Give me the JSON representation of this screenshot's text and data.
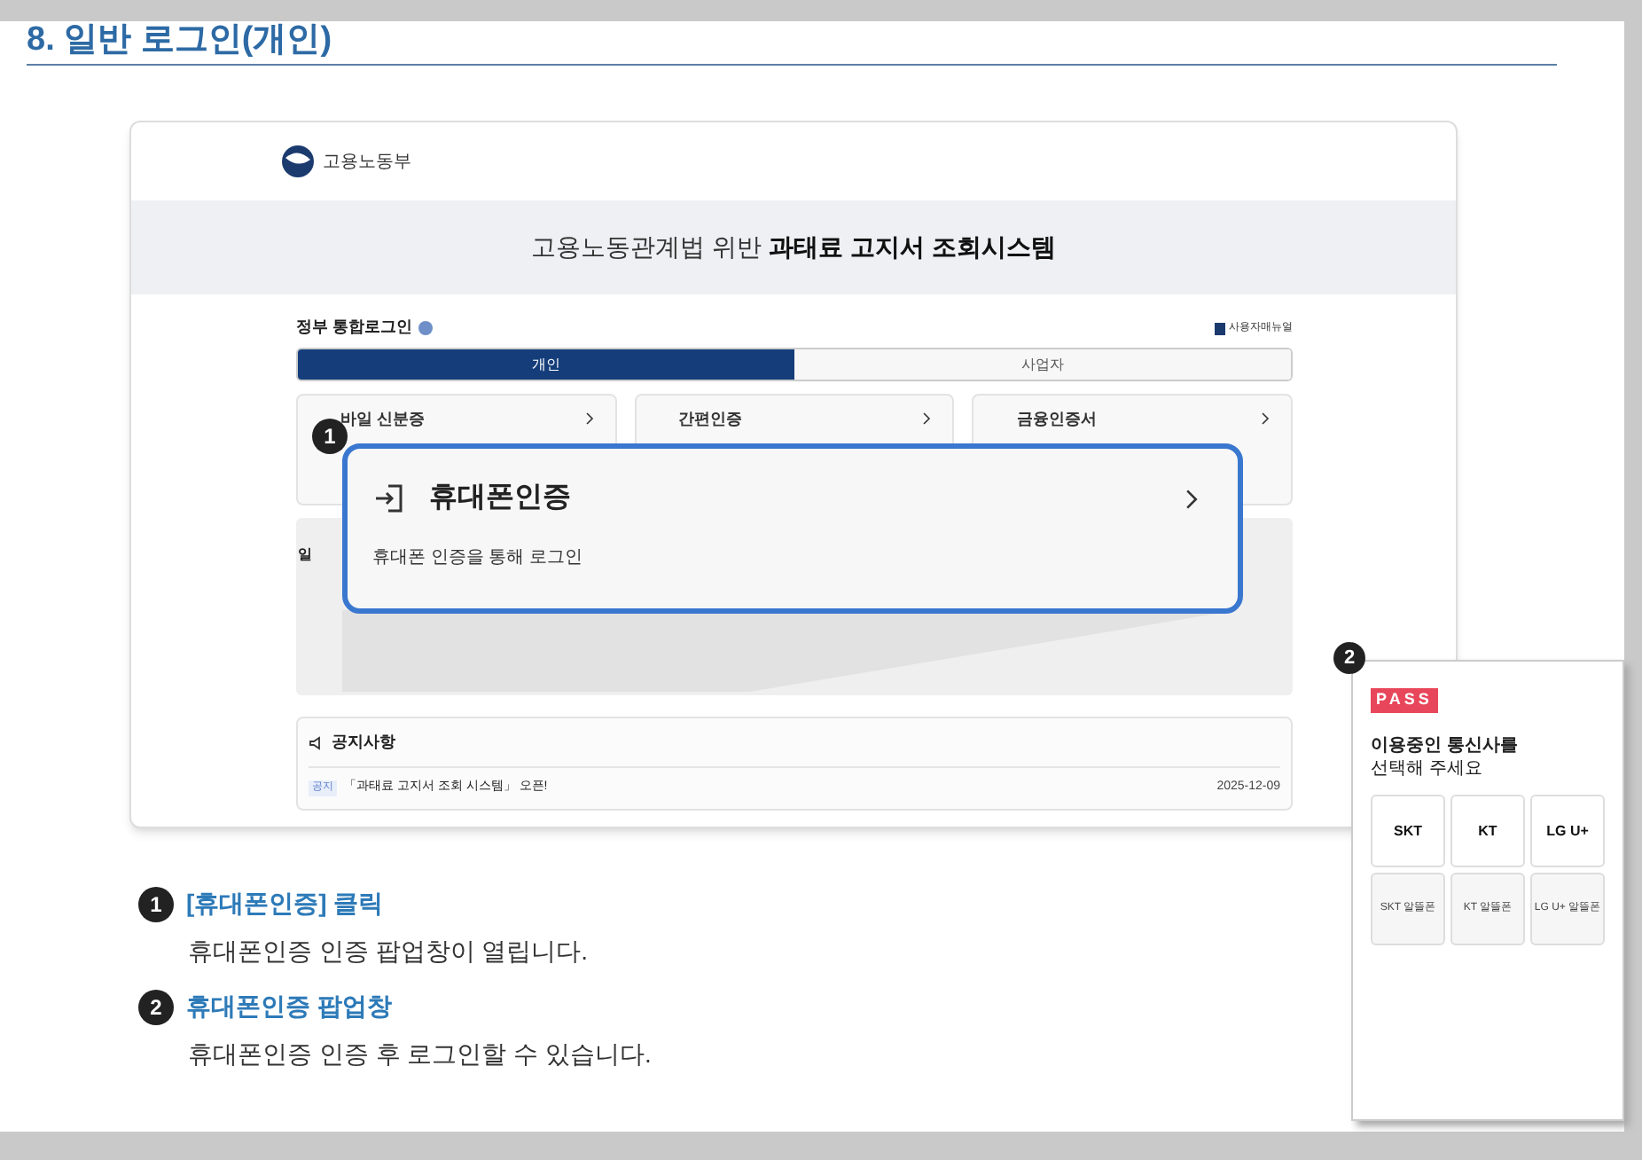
{
  "heading": "8. 일반 로그인(개인)",
  "screenshot": {
    "logo_text": "고용노동부",
    "banner": {
      "title_plain": "고용노동관계법 위반",
      "title_bold": "과태료 고지서 조회시스템"
    },
    "login_title": "정부 통합로그인",
    "manual_link": "사용자매뉴얼",
    "tabs": [
      {
        "label": "개인",
        "selected": true
      },
      {
        "label": "사업자",
        "selected": false
      }
    ],
    "methods": [
      {
        "title": "바일 신분증"
      },
      {
        "title": "간편인증"
      },
      {
        "title": "금융인증서"
      }
    ],
    "section_label": "일",
    "notice": {
      "title": "공지사항",
      "items": [
        {
          "tag": "공지",
          "text": "「과태료 고지서 조회 시스템」 오픈!",
          "date": "2025-12-09"
        }
      ]
    }
  },
  "callout": {
    "badge": "1",
    "title": "휴대폰인증",
    "description": "휴대폰 인증을 통해 로그인"
  },
  "popup": {
    "badge": "2",
    "logo": "PASS",
    "heading_line1": "이용중인 통신사를",
    "heading_line2": "선택해 주세요",
    "carriers": [
      {
        "label": "SKT",
        "kind": "main"
      },
      {
        "label": "KT",
        "kind": "main"
      },
      {
        "label": "LG U+",
        "kind": "main"
      },
      {
        "label": "SKT 알뜰폰",
        "kind": "mvno"
      },
      {
        "label": "KT 알뜰폰",
        "kind": "mvno"
      },
      {
        "label": "LG U+ 알뜰폰",
        "kind": "mvno"
      }
    ]
  },
  "steps": [
    {
      "badge": "1",
      "title": "[휴대폰인증] 클릭",
      "description": "휴대폰인증 인증 팝업창이 열립니다."
    },
    {
      "badge": "2",
      "title": "휴대폰인증 팝업창",
      "description": "휴대폰인증 인증 후 로그인할 수 있습니다."
    }
  ]
}
